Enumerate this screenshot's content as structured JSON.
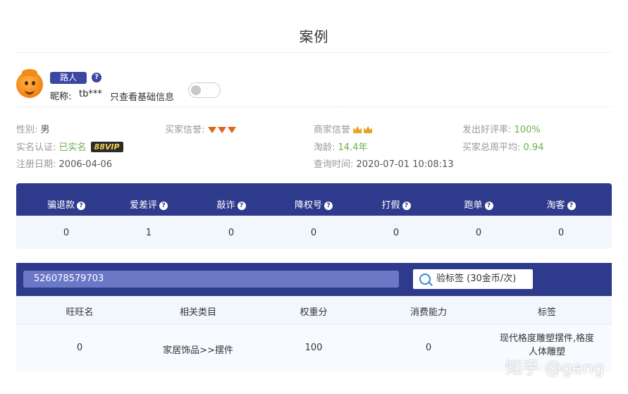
{
  "page": {
    "title": "案例"
  },
  "profile": {
    "level": "路人",
    "help": "?",
    "nickname_label": "昵称:",
    "nickname": "tb***",
    "basic_only_label": "只查看基础信息"
  },
  "info": {
    "gender_label": "性别:",
    "gender": "男",
    "realname_label": "实名认证:",
    "realname": "已实名",
    "vip": "88VIP",
    "register_label": "注册日期:",
    "register": "2006-04-06",
    "buyer_credit_label": "买家信誉:",
    "seller_credit_label": "商家信誉",
    "age_label": "淘龄:",
    "age": "14.4年",
    "query_time_label": "查询时间:",
    "query_time": "2020-07-01 10:08:13",
    "good_rate_label": "发出好评率:",
    "good_rate": "100%",
    "weekly_avg_label": "买家总周平均:",
    "weekly_avg": "0.94"
  },
  "risk": {
    "columns": [
      "骗退款",
      "爱差评",
      "敲诈",
      "降权号",
      "打假",
      "跑单",
      "淘客"
    ],
    "values": [
      "0",
      "1",
      "0",
      "0",
      "0",
      "0",
      "0"
    ]
  },
  "search": {
    "value": "526078579703",
    "button_label": "验标签 (30金币/次)"
  },
  "table": {
    "headers": [
      "旺旺名",
      "相关类目",
      "权重分",
      "消费能力",
      "标签"
    ],
    "row": [
      "0",
      "家居饰品>>摆件",
      "100",
      "0",
      "现代格度雕塑摆件,格度人体雕塑"
    ]
  },
  "watermark": "知乎 @geng",
  "colors": {
    "primary": "#2e3a8c",
    "accent_green": "#6ab04c",
    "row_bg": "#f2f7fd"
  }
}
